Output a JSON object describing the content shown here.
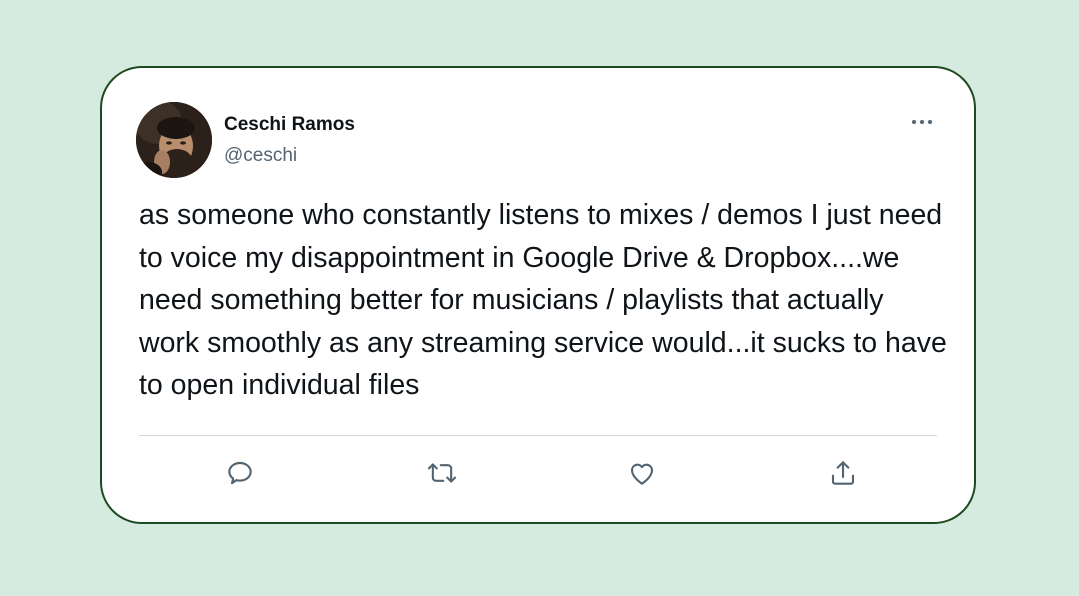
{
  "tweet": {
    "author_name": "Ceschi Ramos",
    "author_handle": "@ceschi",
    "text": "as someone who constantly listens to mixes / demos I just need to voice my disappointment in Google Drive & Dropbox....we need something better for musicians / playlists that actually work smoothly as any streaming service would...it sucks to have to open individual files"
  },
  "icons": {
    "avatar": "author-avatar-photo",
    "more": "more-options-icon",
    "reply": "reply-icon",
    "retweet": "retweet-icon",
    "like": "like-heart-icon",
    "share": "share-upload-icon"
  },
  "colors": {
    "background": "#d6ebdf",
    "card_border": "#1e4a22",
    "icon": "#536471",
    "text": "#0f1419"
  }
}
